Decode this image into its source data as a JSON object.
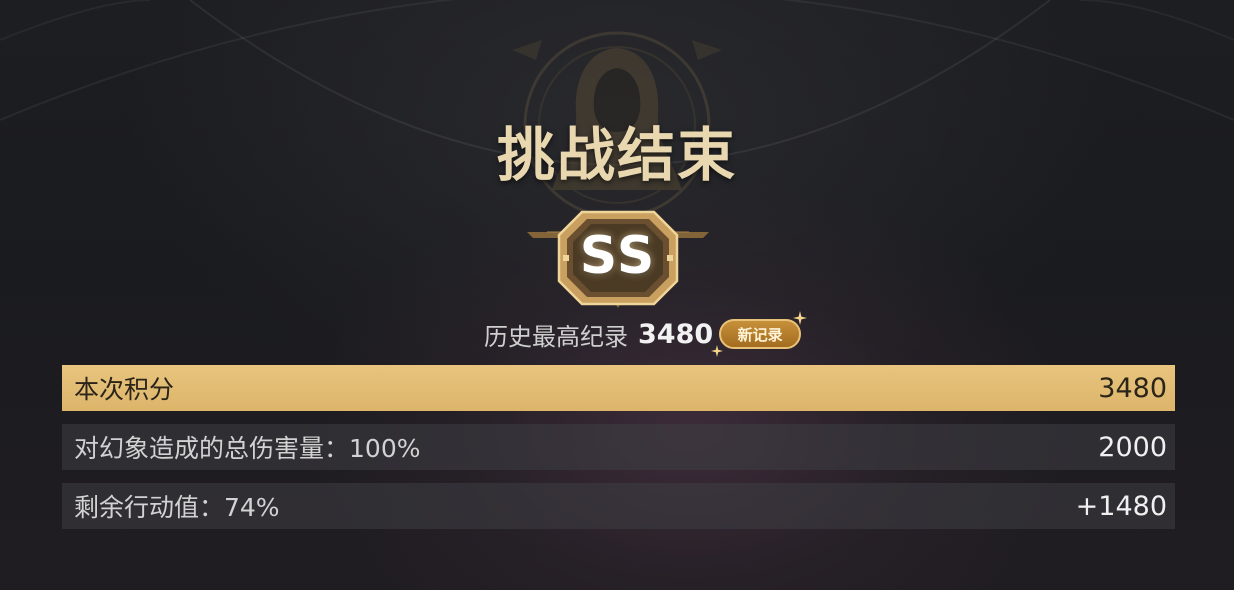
{
  "title": "挑战结束",
  "rank": "SS",
  "record": {
    "label": "历史最高纪录",
    "value": "3480",
    "badge": "新记录"
  },
  "rows": [
    {
      "label": "本次积分",
      "value": "3480"
    },
    {
      "label": "对幻象造成的总伤害量：100%",
      "value": "2000"
    },
    {
      "label": "剩余行动值：74%",
      "value": "+1480"
    }
  ],
  "colors": {
    "accent_gold": "#e8c47e",
    "title_gold": "#e9d7b0",
    "badge_orange": "#b67d2a",
    "background": "#1c1d21"
  },
  "icons": {
    "emblem": "hooded-figure-emblem-icon",
    "sparkle": "sparkle-icon"
  }
}
